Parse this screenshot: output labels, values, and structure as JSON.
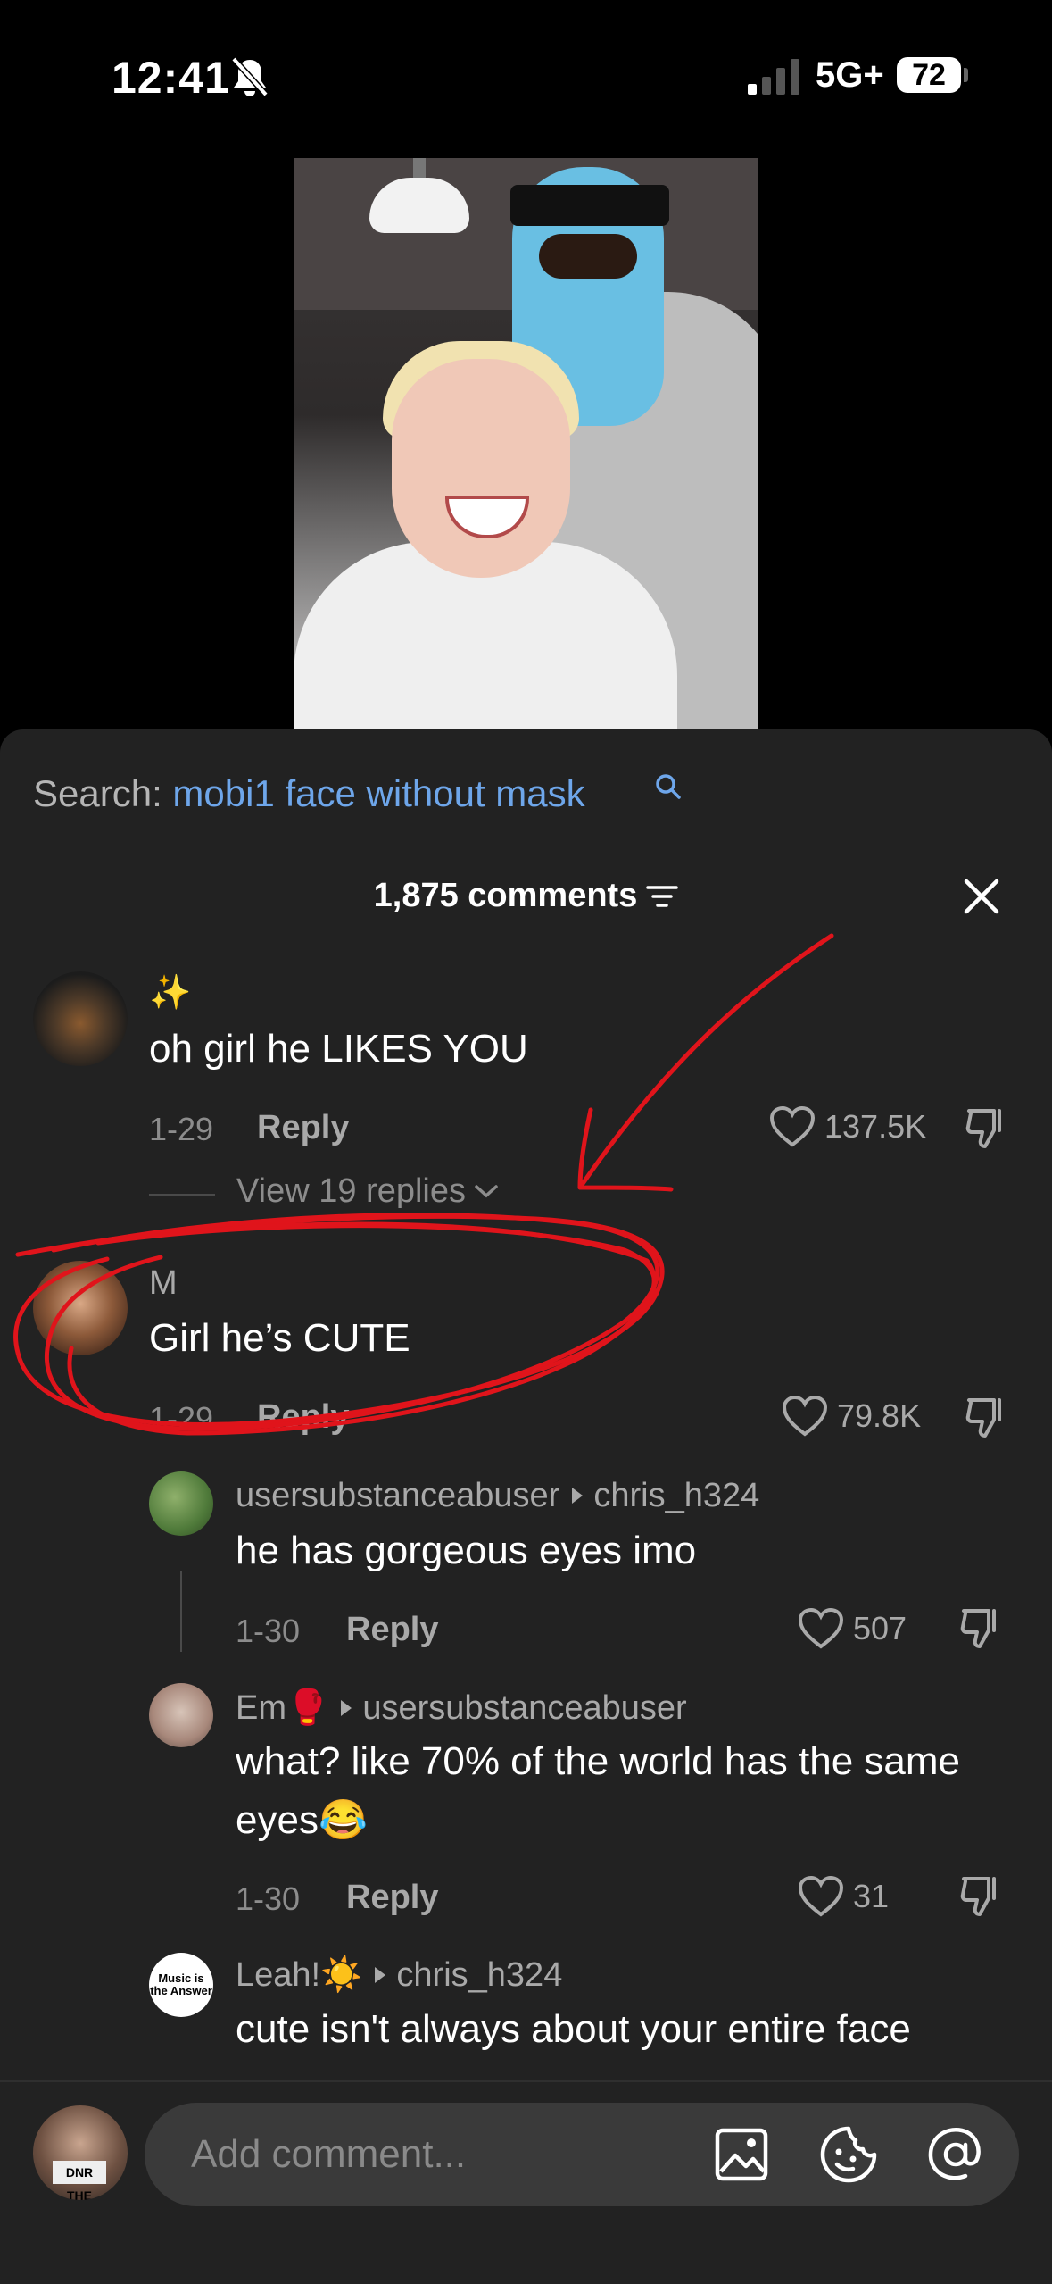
{
  "status_bar": {
    "time": "12:41",
    "network": "5G+",
    "battery": "72"
  },
  "search": {
    "label": "Search:",
    "query": "mobi1 face without mask"
  },
  "comments_header": {
    "count_label": "1,875 comments"
  },
  "comments": [
    {
      "username": "✨",
      "text": "oh girl he LIKES YOU",
      "date": "1-29",
      "reply_label": "Reply",
      "likes": "137.5K",
      "view_replies": "View 19 replies"
    },
    {
      "username": "M",
      "text": "Girl he’s CUTE",
      "date": "1-29",
      "reply_label": "Reply",
      "likes": "79.8K",
      "replies": [
        {
          "username": "usersubstanceabuser",
          "reply_to": "chris_h324",
          "text": "he has gorgeous eyes imo",
          "date": "1-30",
          "reply_label": "Reply",
          "likes": "507"
        },
        {
          "username": "Em🥊",
          "reply_to": "usersubstanceabuser",
          "text_line1": "what? like 70% of the world has the same",
          "text_line2": "eyes😂",
          "date": "1-30",
          "reply_label": "Reply",
          "likes": "31"
        },
        {
          "username": "Leah!☀️",
          "reply_to": "chris_h324",
          "text": "cute isn't always about your entire face",
          "avatar_text": "Music is the Answer"
        }
      ]
    }
  ],
  "composer": {
    "placeholder": "Add comment...",
    "avatar_label": "DNR THE PRETTIEST"
  },
  "icons": [
    "bell-muted-icon",
    "signal-icon",
    "search-icon",
    "filter-icon",
    "close-icon",
    "heart-icon",
    "dislike-icon",
    "chevron-down-icon",
    "image-icon",
    "emoji-icon",
    "mention-icon"
  ],
  "colors": {
    "sheet": "#222222",
    "search_query": "#6ea6ea",
    "annotation": "#e0141b"
  }
}
